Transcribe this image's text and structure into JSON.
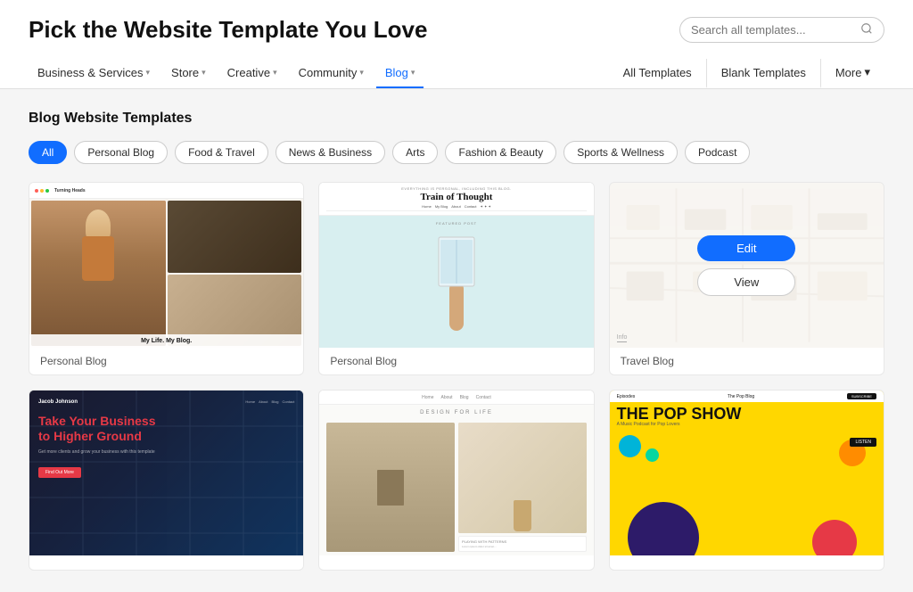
{
  "header": {
    "page_title": "Pick the Website Template You Love",
    "search_placeholder": "Search all templates..."
  },
  "nav": {
    "left_items": [
      {
        "label": "Business & Services",
        "has_chevron": true,
        "active": false
      },
      {
        "label": "Store",
        "has_chevron": true,
        "active": false
      },
      {
        "label": "Creative",
        "has_chevron": true,
        "active": false
      },
      {
        "label": "Community",
        "has_chevron": true,
        "active": false
      },
      {
        "label": "Blog",
        "has_chevron": true,
        "active": true
      }
    ],
    "right_items": [
      {
        "label": "All Templates"
      },
      {
        "label": "Blank Templates"
      },
      {
        "label": "More",
        "has_chevron": true
      }
    ]
  },
  "section": {
    "title": "Blog Website Templates"
  },
  "filters": [
    {
      "label": "All",
      "active": true
    },
    {
      "label": "Personal Blog",
      "active": false
    },
    {
      "label": "Food & Travel",
      "active": false
    },
    {
      "label": "News & Business",
      "active": false
    },
    {
      "label": "Arts",
      "active": false
    },
    {
      "label": "Fashion & Beauty",
      "active": false
    },
    {
      "label": "Sports & Wellness",
      "active": false
    },
    {
      "label": "Podcast",
      "active": false
    }
  ],
  "templates": [
    {
      "label": "Personal Blog"
    },
    {
      "label": "Personal Blog"
    },
    {
      "label": "Travel Blog"
    },
    {
      "label": ""
    },
    {
      "label": ""
    },
    {
      "label": ""
    }
  ],
  "cards": {
    "card1": {
      "overlay_text": "My Life. My Blog."
    },
    "card2": {
      "tagline": "Everything is personal, including this blog.",
      "title": "Train of Thought",
      "featured_label": "FEATURED POST"
    },
    "card3": {
      "info_label": "Info",
      "edit_btn": "Edit",
      "view_btn": "View"
    },
    "card4": {
      "headline_part1": "Take Your",
      "headline_highlight": "Business",
      "headline_part2": "to Higher Ground"
    },
    "card5": {
      "tagline": "DESIGN FOR LIFE",
      "card_text": "PLAYING WITH PATTERNS"
    },
    "card6": {
      "nav_item1": "Episodes",
      "nav_item2": "The Pop Blog",
      "subscribe_btn": "SUBSCRIBE",
      "title": "THE POP SHOW",
      "sub": "A Music Podcast for Pop Lovers",
      "listen_btn": "LISTEN"
    }
  },
  "icons": {
    "search": "🔍",
    "chevron": "▾"
  }
}
